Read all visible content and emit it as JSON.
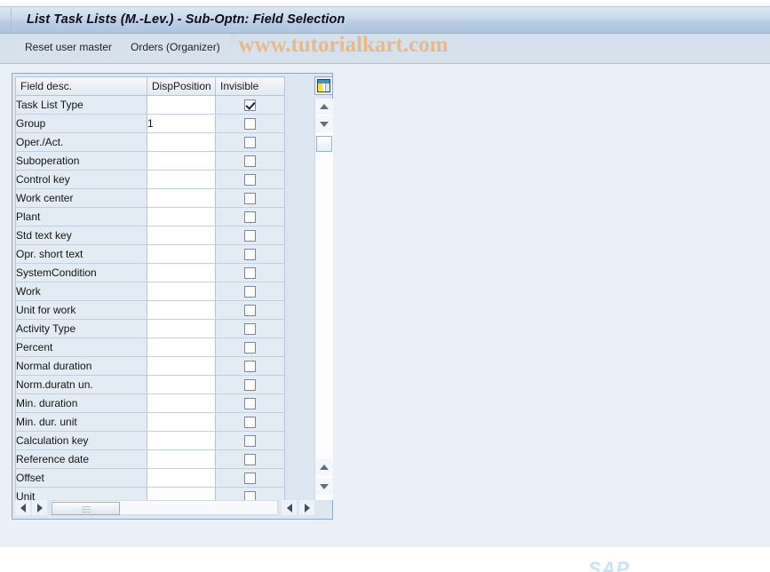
{
  "window": {
    "title": "List Task Lists (M.-Lev.) - Sub-Optn: Field Selection"
  },
  "toolbar": {
    "reset_user_master_label": "Reset user master",
    "orders_organizer_label": "Orders (Organizer)"
  },
  "watermark": {
    "copyright_symbol": "©",
    "text": "www.tutorialkart.com"
  },
  "branding": {
    "sap_logo": "SAP"
  },
  "table": {
    "config_icon_name": "table-settings-icon",
    "columns": [
      {
        "key": "desc",
        "label": "Field desc."
      },
      {
        "key": "pos",
        "label": "DispPosition"
      },
      {
        "key": "inv",
        "label": "Invisible"
      }
    ],
    "rows": [
      {
        "desc": "Task List Type",
        "pos": "",
        "inv": true
      },
      {
        "desc": "Group",
        "pos": "1",
        "inv": false
      },
      {
        "desc": "Oper./Act.",
        "pos": "",
        "inv": false
      },
      {
        "desc": "Suboperation",
        "pos": "",
        "inv": false
      },
      {
        "desc": "Control key",
        "pos": "",
        "inv": false
      },
      {
        "desc": "Work center",
        "pos": "",
        "inv": false
      },
      {
        "desc": "Plant",
        "pos": "",
        "inv": false
      },
      {
        "desc": "Std text key",
        "pos": "",
        "inv": false
      },
      {
        "desc": "Opr. short text",
        "pos": "",
        "inv": false
      },
      {
        "desc": "SystemCondition",
        "pos": "",
        "inv": false
      },
      {
        "desc": "Work",
        "pos": "",
        "inv": false
      },
      {
        "desc": "Unit for work",
        "pos": "",
        "inv": false
      },
      {
        "desc": "Activity Type",
        "pos": "",
        "inv": false
      },
      {
        "desc": "Percent",
        "pos": "",
        "inv": false
      },
      {
        "desc": "Normal duration",
        "pos": "",
        "inv": false
      },
      {
        "desc": "Norm.duratn un.",
        "pos": "",
        "inv": false
      },
      {
        "desc": "Min. duration",
        "pos": "",
        "inv": false
      },
      {
        "desc": "Min. dur. unit",
        "pos": "",
        "inv": false
      },
      {
        "desc": "Calculation key",
        "pos": "",
        "inv": false
      },
      {
        "desc": "Reference date",
        "pos": "",
        "inv": false
      },
      {
        "desc": "Offset",
        "pos": "",
        "inv": false
      },
      {
        "desc": "Unit",
        "pos": "",
        "inv": false
      }
    ]
  },
  "scrollbars": {
    "vertical_up_icon": "caret-up-icon",
    "vertical_down_icon": "caret-down-icon",
    "horizontal_left_icon": "caret-left-icon",
    "horizontal_right_icon": "caret-right-icon"
  },
  "colors": {
    "title_bar": "#c6d7e9",
    "toolbar": "#d6e1ee",
    "page_bg": "#eaf0f8",
    "grid_alt_cell": "#e3ebf5",
    "watermark": "#e8b98a",
    "accent_border": "#8fa8c4"
  }
}
